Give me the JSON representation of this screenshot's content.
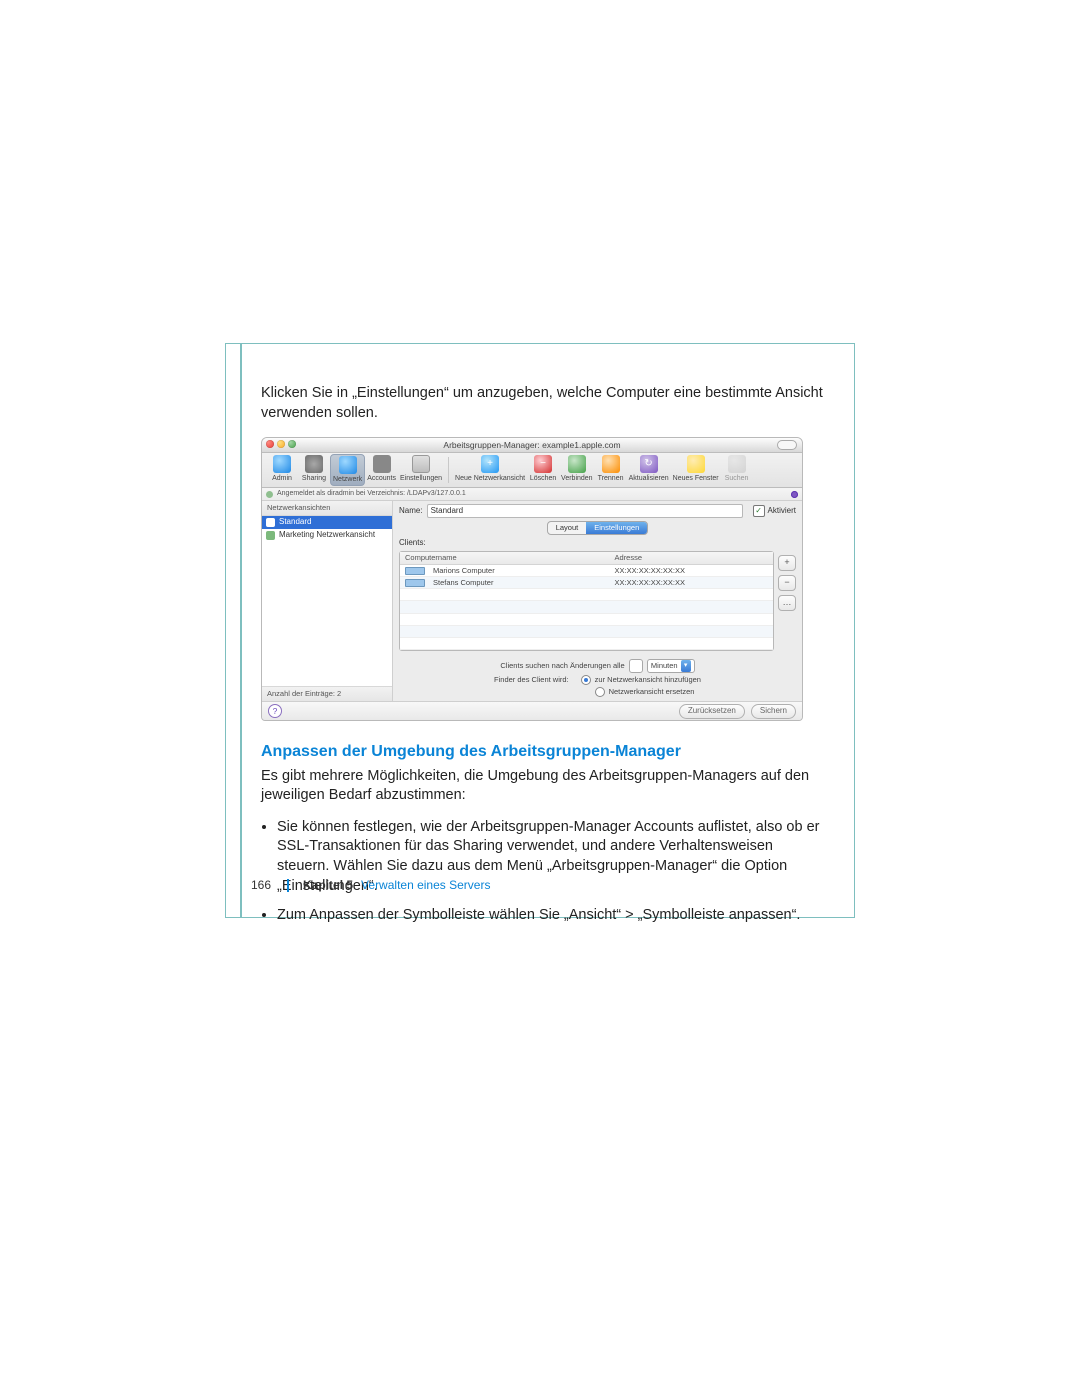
{
  "body": {
    "intro": "Klicken Sie in „Einstellungen“ um anzugeben, welche Computer eine bestimmte Ansicht verwenden sollen.",
    "heading": "Anpassen der Umgebung des Arbeitsgruppen-Manager",
    "section_intro": "Es gibt mehrere Möglichkeiten, die Umgebung des Arbeitsgruppen-Managers auf den jeweiligen Bedarf abzustimmen:",
    "bullets": [
      "Sie können festlegen, wie der Arbeitsgruppen-Manager Accounts auflistet, also ob er SSL-Transaktionen für das Sharing verwendet, und andere Verhaltensweisen steuern. Wählen Sie dazu aus dem Menü „Arbeitsgruppen-Manager“ die Option „Einstellungen“.",
      "Zum Anpassen der Symbolleiste wählen Sie „Ansicht“ > „Symbolleiste anpassen“."
    ]
  },
  "window": {
    "title": "Arbeitsgruppen-Manager: example1.apple.com",
    "toolbar": [
      "Admin",
      "Sharing",
      "Netzwerk",
      "Accounts",
      "Einstellungen",
      "Neue Netzwerkansicht",
      "Löschen",
      "Verbinden",
      "Trennen",
      "Aktualisieren",
      "Neues Fenster",
      "Suchen"
    ],
    "auth_strip": "Angemeldet als diradmin bei Verzeichnis: /LDAPv3/127.0.0.1",
    "sidebar": {
      "heading": "Netzwerkansichten",
      "items": [
        "Standard",
        "Marketing Netzwerkansicht"
      ],
      "footer": "Anzahl der Einträge: 2"
    },
    "detail": {
      "name_label": "Name:",
      "name_value": "Standard",
      "enabled_label": "Aktiviert",
      "tabs": [
        "Layout",
        "Einstellungen"
      ],
      "clients_label": "Clients:",
      "columns": [
        "Computername",
        "Adresse"
      ],
      "rows": [
        {
          "name": "Marions Computer",
          "addr": "XX:XX:XX:XX:XX:XX"
        },
        {
          "name": "Stefans Computer",
          "addr": "XX:XX:XX:XX:XX:XX"
        }
      ],
      "poll_label": "Clients suchen nach Änderungen alle",
      "poll_unit": "Minuten",
      "finder_label": "Finder des Client wird:",
      "radio_add": "zur Netzwerkansicht hinzufügen",
      "radio_replace": "Netzwerkansicht ersetzen"
    },
    "footer": {
      "revert": "Zurücksetzen",
      "save": "Sichern"
    }
  },
  "footer": {
    "page": "166",
    "chapter": "Kapitel 5",
    "chapter_title": "Verwalten eines Servers"
  }
}
